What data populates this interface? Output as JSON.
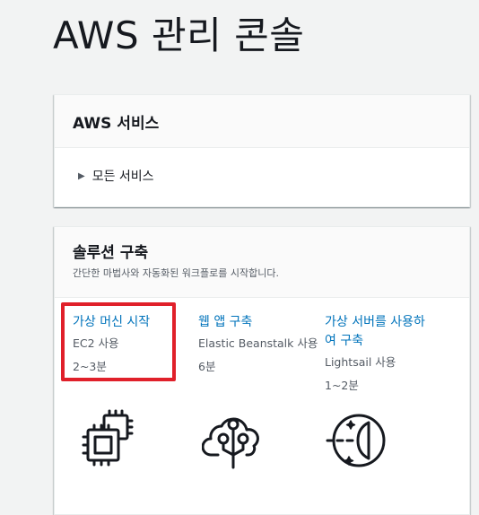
{
  "page": {
    "title": "AWS 관리 콘솔"
  },
  "services": {
    "title": "AWS 서비스",
    "all_services": "모든 서비스"
  },
  "solutions": {
    "title": "솔루션 구축",
    "subtitle": "간단한 마법사와 자동화된 워크플로를 시작합니다.",
    "items": [
      {
        "title": "가상 머신 시작",
        "meta1": "EC2 사용",
        "meta2": "2~3분",
        "icon": "chip-icon"
      },
      {
        "title": "웹 앱 구축",
        "meta1": "Elastic Beanstalk 사용",
        "meta2": "6분",
        "icon": "cloud-tree-icon"
      },
      {
        "title_line1": "가상 서버를 사용하",
        "title_line2": "여 구축",
        "meta1": "Lightsail 사용",
        "meta2": "1~2분",
        "icon": "lightsail-icon"
      }
    ]
  },
  "colors": {
    "link": "#0073bb",
    "highlight": "#e0202a",
    "background": "#f2f3f3"
  }
}
